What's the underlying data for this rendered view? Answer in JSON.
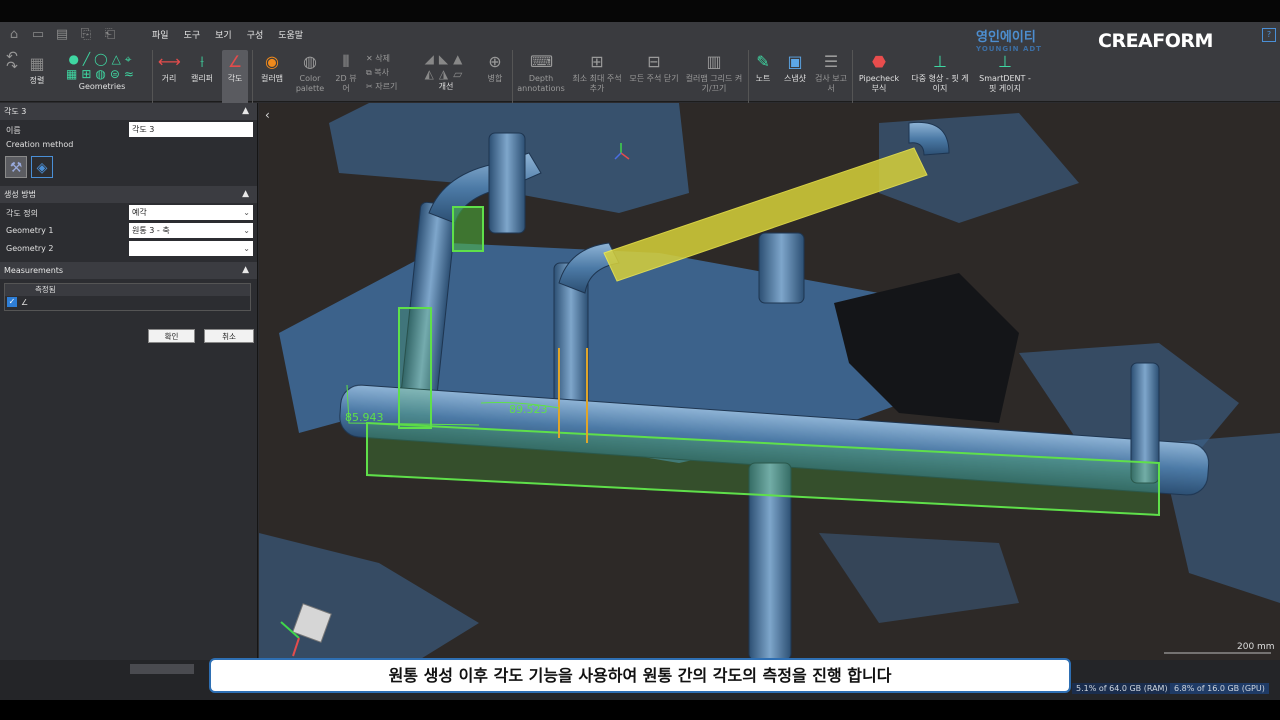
{
  "menu": [
    "파일",
    "도구",
    "보기",
    "구성",
    "도움말"
  ],
  "ribbon": {
    "align_label": "정렬",
    "geometries_label": "Geometries",
    "distance_label": "거리",
    "caliper_label": "캘리퍼",
    "angle_label": "각도",
    "colormap_label": "컬러맵",
    "color_palette_label": "Color palette",
    "view2d_label": "2D 뷰어",
    "delete_label": "삭제",
    "copy_label": "복사",
    "cut_label": "자르기",
    "improve_label": "개선",
    "merge_label": "병합",
    "depth_annotations_label": "Depth annotations",
    "minmax_label": "최소 최대 주석 추가",
    "close_all_label": "모든 주석 닫기",
    "colormap_grid_label": "컬러맵 그리드 켜기/끄기",
    "note_label": "노트",
    "snapshot_label": "스냅샷",
    "report_label": "검사 보고서",
    "pipecheck_label": "Pipecheck 부식",
    "multi_label": "다중 형상 - 핏 게이지",
    "smartdent_label": "SmartDENT - 핏 게이지"
  },
  "logos": {
    "ysi": "영인에이티",
    "ysi_sub": "YOUNGIN ADT",
    "creaform": "CREAFORM"
  },
  "panel": {
    "title": "각도 3",
    "name_label": "이름",
    "name_value": "각도 3",
    "creation_method": "Creation method",
    "section_create": "생성 방법",
    "angle_def_label": "각도 정의",
    "angle_def_value": "예각",
    "geom1_label": "Geometry 1",
    "geom1_value": "원통 3 - 축",
    "geom2_label": "Geometry 2",
    "geom2_value": "",
    "section_meas": "Measurements",
    "meas_col": "측정됨",
    "meas_row": "∠",
    "ok": "확인",
    "cancel": "취소"
  },
  "viewport": {
    "angle1": "85.943",
    "angle2": "89.523",
    "scale": "200 mm"
  },
  "status": {
    "ram": "5.1% of 64.0 GB (RAM)",
    "gpu": "6.8% of 16.0 GB (GPU)"
  },
  "subtitle": "원통 생성 이후 각도 기능을 사용하여 원통 간의 각도의 측정을 진행 합니다"
}
